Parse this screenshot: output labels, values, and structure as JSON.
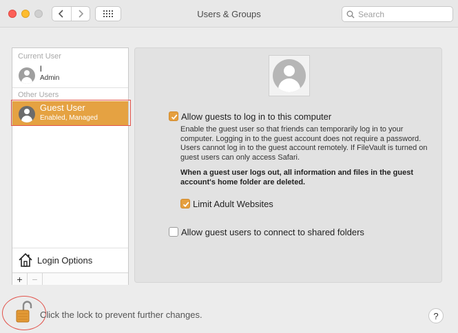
{
  "window": {
    "title": "Users & Groups",
    "search_placeholder": "Search"
  },
  "sidebar": {
    "current_user_label": "Current User",
    "other_users_label": "Other Users",
    "users": [
      {
        "name": "l",
        "role": "Admin",
        "selected": false
      },
      {
        "name": "Guest User",
        "role": "Enabled, Managed",
        "selected": true
      }
    ],
    "login_options_label": "Login Options",
    "add_label": "+",
    "remove_label": "−"
  },
  "guest_panel": {
    "allow_guests_label": "Allow guests to log in to this computer",
    "allow_guests_checked": true,
    "description": "Enable the guest user so that friends can temporarily log in to your computer. Logging in to the guest account does not require a password. Users cannot log in to the guest account remotely. If FileVault is turned on guest users can only access Safari.",
    "warning": "When a guest user logs out, all information and files in the guest account's home folder are deleted.",
    "limit_adult_label": "Limit Adult Websites",
    "limit_adult_checked": true,
    "shared_folders_label": "Allow guest users to connect to shared folders",
    "shared_folders_checked": false
  },
  "footer": {
    "lock_text": "Click the lock to prevent further changes.",
    "help_label": "?"
  },
  "colors": {
    "accent": "#e5a242",
    "highlight_outline": "#e2534b"
  }
}
